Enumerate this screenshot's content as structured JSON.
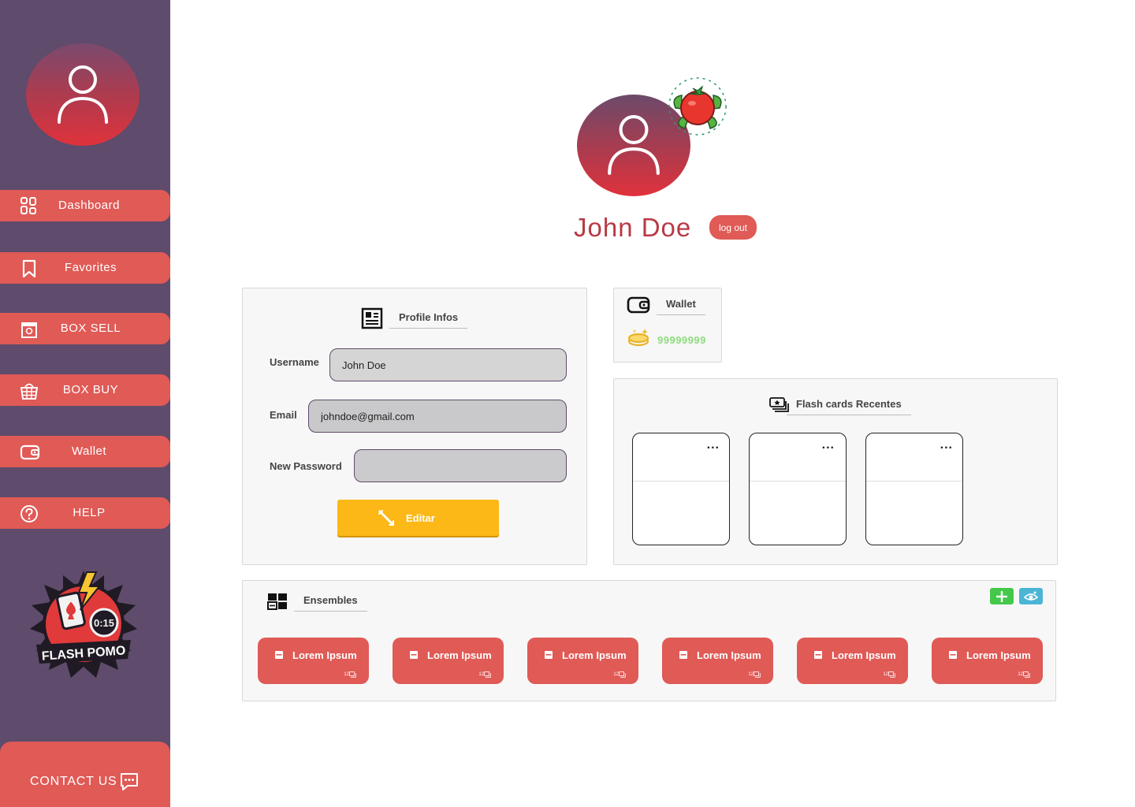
{
  "sidebar": {
    "nav": [
      {
        "label": "Dashboard",
        "icon": "dashboard-icon"
      },
      {
        "label": "Favorites",
        "icon": "bookmark-icon"
      },
      {
        "label": "BOX SELL",
        "icon": "store-icon"
      },
      {
        "label": "BOX BUY",
        "icon": "basket-icon"
      },
      {
        "label": "Wallet",
        "icon": "wallet-icon"
      },
      {
        "label": "HELP",
        "icon": "help-icon"
      }
    ],
    "logo_text": "FLASH POMO",
    "logo_timer": "0:15",
    "contact_label": "CONTACT US"
  },
  "header": {
    "user_name": "John Doe",
    "logout_label": "log out"
  },
  "profile": {
    "title": "Profile Infos",
    "username_label": "Username",
    "username_value": "John Doe",
    "email_label": "Email",
    "email_value": "johndoe@gmail.com",
    "password_label": "New Password",
    "password_value": "",
    "edit_label": "Editar"
  },
  "wallet": {
    "title": "Wallet",
    "balance": "99999999"
  },
  "flash_cards": {
    "title": "Flash cards Recentes",
    "dots": "..."
  },
  "ensembles": {
    "title": "Ensembles",
    "items": [
      {
        "label": "Lorem Ipsum",
        "count": "12"
      },
      {
        "label": "Lorem Ipsum",
        "count": "12"
      },
      {
        "label": "Lorem Ipsum",
        "count": "12"
      },
      {
        "label": "Lorem Ipsum",
        "count": "12"
      },
      {
        "label": "Lorem Ipsum",
        "count": "12"
      },
      {
        "label": "Lorem Ipsum",
        "count": "12"
      }
    ]
  },
  "colors": {
    "sidebar_bg": "#5f4b6b",
    "accent_red": "#e05a56",
    "name_red": "#b83a45",
    "edit_yellow": "#fbb817",
    "balance_green": "#8ddc7f",
    "add_green": "#45c84a",
    "view_blue": "#4bb5d6"
  }
}
